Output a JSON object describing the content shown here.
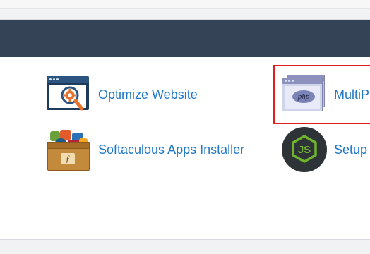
{
  "tools": {
    "optimize": {
      "label": "Optimize Website",
      "icon": "magnifier-gear-icon"
    },
    "multiphp": {
      "label": "MultiPHP",
      "icon": "php-window-icon",
      "icon_text": "php"
    },
    "softaculous": {
      "label": "Softaculous Apps Installer",
      "icon": "softaculous-box-icon"
    },
    "setup": {
      "label": "Setup",
      "icon": "nodejs-icon",
      "icon_text": "JS"
    }
  },
  "colors": {
    "header": "#344456",
    "link": "#1f78c8",
    "highlight": "#e02020",
    "node_green": "#6fb52c"
  }
}
